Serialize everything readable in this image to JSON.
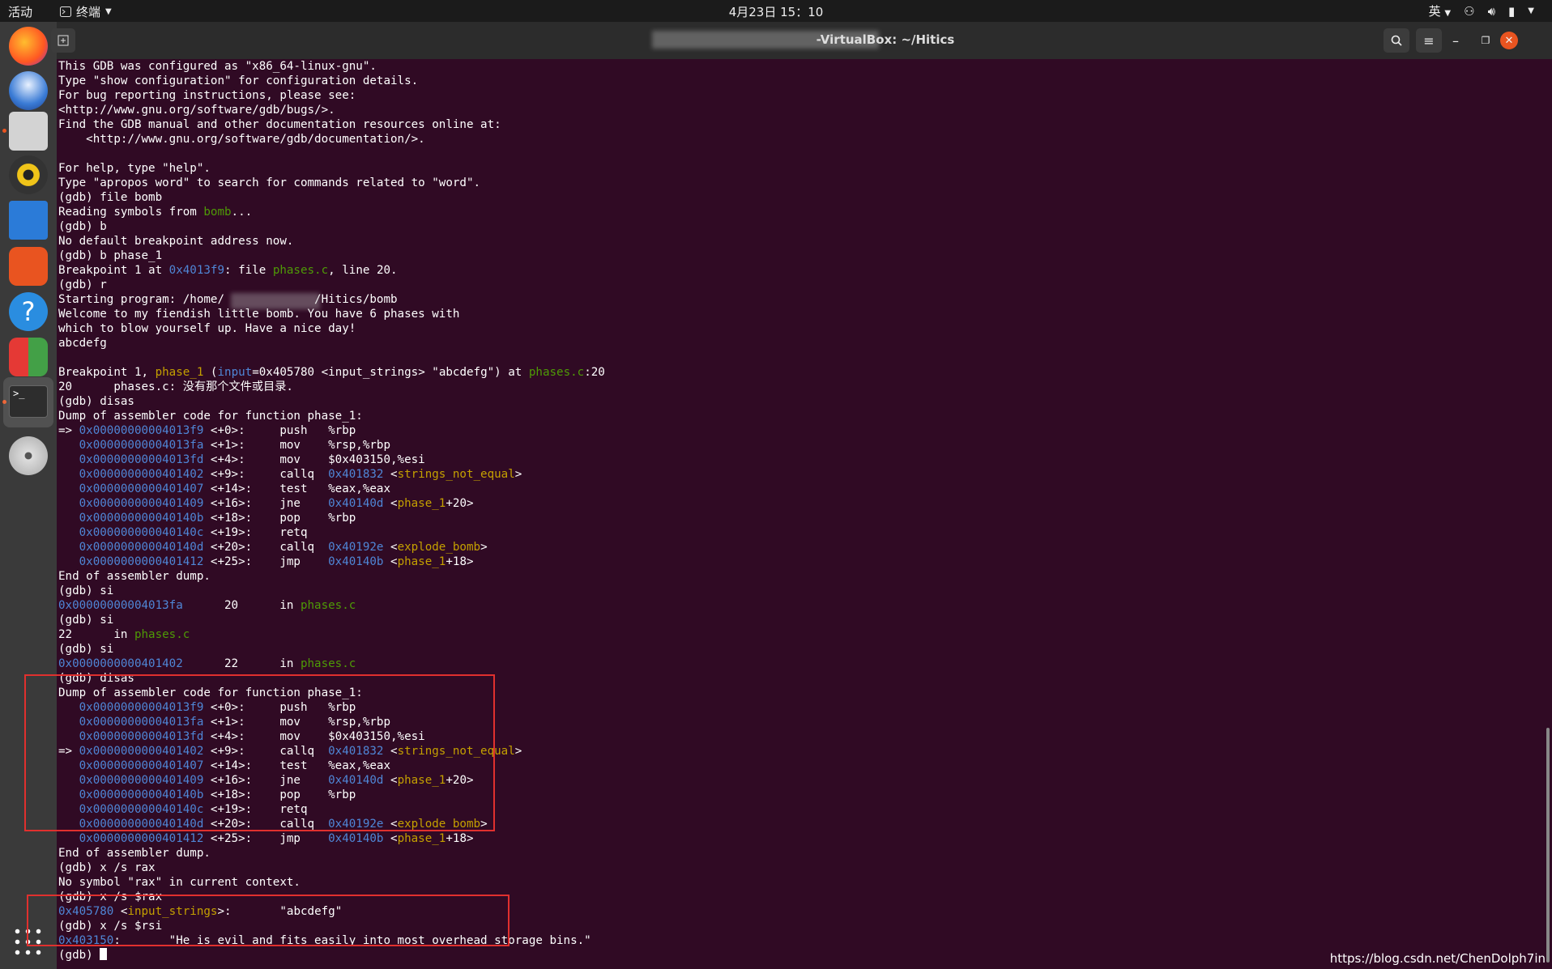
{
  "topbar": {
    "activities": "活动",
    "app_menu": "终端",
    "clock": "4月23日  15：10",
    "input_method": "英"
  },
  "window": {
    "title": "-VirtualBox: ~/Hitics"
  },
  "watermark": "https://blog.csdn.net/ChenDolph7in",
  "colors": {
    "terminal_bg": "#300a24",
    "address": "#4f86d6",
    "filename": "#4e9a06",
    "symbol": "#c4a000",
    "highlight_box": "#e0302e"
  },
  "dock": {
    "icons": [
      "firefox-icon",
      "thunderbird-icon",
      "files-icon",
      "rhythmbox-icon",
      "writer-icon",
      "software-icon",
      "help-icon",
      "virtualbox-icon",
      "terminal-icon",
      "disc-icon",
      "apps-grid-icon"
    ]
  },
  "terminal": {
    "lines": [
      [
        {
          "t": "This GDB was configured as \"x86_64-linux-gnu\"."
        }
      ],
      [
        {
          "t": "Type \"show configuration\" for configuration details."
        }
      ],
      [
        {
          "t": "For bug reporting instructions, please see:"
        }
      ],
      [
        {
          "t": "<http://www.gnu.org/software/gdb/bugs/>."
        }
      ],
      [
        {
          "t": "Find the GDB manual and other documentation resources online at:"
        }
      ],
      [
        {
          "t": "    <http://www.gnu.org/software/gdb/documentation/>."
        }
      ],
      [
        {
          "t": ""
        }
      ],
      [
        {
          "t": "For help, type \"help\"."
        }
      ],
      [
        {
          "t": "Type \"apropos word\" to search for commands related to \"word\"."
        }
      ],
      [
        {
          "t": "(gdb) file bomb"
        }
      ],
      [
        {
          "t": "Reading symbols from "
        },
        {
          "t": "bomb",
          "c": "g"
        },
        {
          "t": "..."
        }
      ],
      [
        {
          "t": "(gdb) b"
        }
      ],
      [
        {
          "t": "No default breakpoint address now."
        }
      ],
      [
        {
          "t": "(gdb) b phase_1"
        }
      ],
      [
        {
          "t": "Breakpoint 1 at "
        },
        {
          "t": "0x4013f9",
          "c": "b"
        },
        {
          "t": ": file "
        },
        {
          "t": "phases.c",
          "c": "g"
        },
        {
          "t": ", line 20."
        }
      ],
      [
        {
          "t": "(gdb) r"
        }
      ],
      [
        {
          "t": "Starting program: /home/"
        },
        {
          "t": "             "
        },
        {
          "t": "/Hitics/bomb"
        }
      ],
      [
        {
          "t": "Welcome to my fiendish little bomb. You have 6 phases with"
        }
      ],
      [
        {
          "t": "which to blow yourself up. Have a nice day!"
        }
      ],
      [
        {
          "t": "abcdefg"
        }
      ],
      [
        {
          "t": ""
        }
      ],
      [
        {
          "t": "Breakpoint 1, "
        },
        {
          "t": "phase_1",
          "c": "o"
        },
        {
          "t": " ("
        },
        {
          "t": "input",
          "c": "b"
        },
        {
          "t": "=0x405780 <input_strings> \"abcdefg\") at "
        },
        {
          "t": "phases.c",
          "c": "g"
        },
        {
          "t": ":20"
        }
      ],
      [
        {
          "t": "20      phases.c: 没有那个文件或目录."
        }
      ],
      [
        {
          "t": "(gdb) disas"
        }
      ],
      [
        {
          "t": "Dump of assembler code for function phase_1:"
        }
      ],
      [
        {
          "t": "=> "
        },
        {
          "t": "0x00000000004013f9",
          "c": "b"
        },
        {
          "t": " <+0>:     push   %rbp"
        }
      ],
      [
        {
          "t": "   "
        },
        {
          "t": "0x00000000004013fa",
          "c": "b"
        },
        {
          "t": " <+1>:     mov    %rsp,%rbp"
        }
      ],
      [
        {
          "t": "   "
        },
        {
          "t": "0x00000000004013fd",
          "c": "b"
        },
        {
          "t": " <+4>:     mov    $0x403150,%esi"
        }
      ],
      [
        {
          "t": "   "
        },
        {
          "t": "0x0000000000401402",
          "c": "b"
        },
        {
          "t": " <+9>:     callq  "
        },
        {
          "t": "0x401832",
          "c": "b"
        },
        {
          "t": " <"
        },
        {
          "t": "strings_not_equal",
          "c": "o"
        },
        {
          "t": ">"
        }
      ],
      [
        {
          "t": "   "
        },
        {
          "t": "0x0000000000401407",
          "c": "b"
        },
        {
          "t": " <+14>:    test   %eax,%eax"
        }
      ],
      [
        {
          "t": "   "
        },
        {
          "t": "0x0000000000401409",
          "c": "b"
        },
        {
          "t": " <+16>:    jne    "
        },
        {
          "t": "0x40140d",
          "c": "b"
        },
        {
          "t": " <"
        },
        {
          "t": "phase_1",
          "c": "o"
        },
        {
          "t": "+20>"
        }
      ],
      [
        {
          "t": "   "
        },
        {
          "t": "0x000000000040140b",
          "c": "b"
        },
        {
          "t": " <+18>:    pop    %rbp"
        }
      ],
      [
        {
          "t": "   "
        },
        {
          "t": "0x000000000040140c",
          "c": "b"
        },
        {
          "t": " <+19>:    retq"
        }
      ],
      [
        {
          "t": "   "
        },
        {
          "t": "0x000000000040140d",
          "c": "b"
        },
        {
          "t": " <+20>:    callq  "
        },
        {
          "t": "0x40192e",
          "c": "b"
        },
        {
          "t": " <"
        },
        {
          "t": "explode_bomb",
          "c": "o"
        },
        {
          "t": ">"
        }
      ],
      [
        {
          "t": "   "
        },
        {
          "t": "0x0000000000401412",
          "c": "b"
        },
        {
          "t": " <+25>:    jmp    "
        },
        {
          "t": "0x40140b",
          "c": "b"
        },
        {
          "t": " <"
        },
        {
          "t": "phase_1",
          "c": "o"
        },
        {
          "t": "+18>"
        }
      ],
      [
        {
          "t": "End of assembler dump."
        }
      ],
      [
        {
          "t": "(gdb) si"
        }
      ],
      [
        {
          "t": "0x00000000004013fa",
          "c": "b"
        },
        {
          "t": "      20      in "
        },
        {
          "t": "phases.c",
          "c": "g"
        }
      ],
      [
        {
          "t": "(gdb) si"
        }
      ],
      [
        {
          "t": "22      in "
        },
        {
          "t": "phases.c",
          "c": "g"
        }
      ],
      [
        {
          "t": "(gdb) si"
        }
      ],
      [
        {
          "t": "0x0000000000401402",
          "c": "b"
        },
        {
          "t": "      22      in "
        },
        {
          "t": "phases.c",
          "c": "g"
        }
      ],
      [
        {
          "t": "(gdb) disas"
        }
      ],
      [
        {
          "t": "Dump of assembler code for function phase_1:"
        }
      ],
      [
        {
          "t": "   "
        },
        {
          "t": "0x00000000004013f9",
          "c": "b"
        },
        {
          "t": " <+0>:     push   %rbp"
        }
      ],
      [
        {
          "t": "   "
        },
        {
          "t": "0x00000000004013fa",
          "c": "b"
        },
        {
          "t": " <+1>:     mov    %rsp,%rbp"
        }
      ],
      [
        {
          "t": "   "
        },
        {
          "t": "0x00000000004013fd",
          "c": "b"
        },
        {
          "t": " <+4>:     mov    $0x403150,%esi"
        }
      ],
      [
        {
          "t": "=> "
        },
        {
          "t": "0x0000000000401402",
          "c": "b"
        },
        {
          "t": " <+9>:     callq  "
        },
        {
          "t": "0x401832",
          "c": "b"
        },
        {
          "t": " <"
        },
        {
          "t": "strings_not_equal",
          "c": "o"
        },
        {
          "t": ">"
        }
      ],
      [
        {
          "t": "   "
        },
        {
          "t": "0x0000000000401407",
          "c": "b"
        },
        {
          "t": " <+14>:    test   %eax,%eax"
        }
      ],
      [
        {
          "t": "   "
        },
        {
          "t": "0x0000000000401409",
          "c": "b"
        },
        {
          "t": " <+16>:    jne    "
        },
        {
          "t": "0x40140d",
          "c": "b"
        },
        {
          "t": " <"
        },
        {
          "t": "phase_1",
          "c": "o"
        },
        {
          "t": "+20>"
        }
      ],
      [
        {
          "t": "   "
        },
        {
          "t": "0x000000000040140b",
          "c": "b"
        },
        {
          "t": " <+18>:    pop    %rbp"
        }
      ],
      [
        {
          "t": "   "
        },
        {
          "t": "0x000000000040140c",
          "c": "b"
        },
        {
          "t": " <+19>:    retq"
        }
      ],
      [
        {
          "t": "   "
        },
        {
          "t": "0x000000000040140d",
          "c": "b"
        },
        {
          "t": " <+20>:    callq  "
        },
        {
          "t": "0x40192e",
          "c": "b"
        },
        {
          "t": " <"
        },
        {
          "t": "explode_bomb",
          "c": "o"
        },
        {
          "t": ">"
        }
      ],
      [
        {
          "t": "   "
        },
        {
          "t": "0x0000000000401412",
          "c": "b"
        },
        {
          "t": " <+25>:    jmp    "
        },
        {
          "t": "0x40140b",
          "c": "b"
        },
        {
          "t": " <"
        },
        {
          "t": "phase_1",
          "c": "o"
        },
        {
          "t": "+18>"
        }
      ],
      [
        {
          "t": "End of assembler dump."
        }
      ],
      [
        {
          "t": "(gdb) x /s rax"
        }
      ],
      [
        {
          "t": "No symbol \"rax\" in current context."
        }
      ],
      [
        {
          "t": "(gdb) x /s $rax"
        }
      ],
      [
        {
          "t": "0x405780",
          "c": "b"
        },
        {
          "t": " <"
        },
        {
          "t": "input_strings",
          "c": "o"
        },
        {
          "t": ">:       \"abcdefg\""
        }
      ],
      [
        {
          "t": "(gdb) x /s $rsi"
        }
      ],
      [
        {
          "t": "0x403150",
          "c": "b"
        },
        {
          "t": ":       \"He is evil and fits easily into most overhead storage bins.\""
        }
      ],
      [
        {
          "t": "(gdb) "
        }
      ]
    ]
  }
}
